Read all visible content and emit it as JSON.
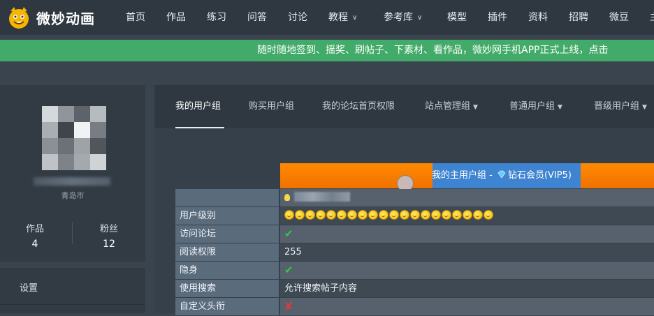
{
  "brand": {
    "name": "微妙动画"
  },
  "nav": {
    "items": [
      {
        "label": "首页"
      },
      {
        "label": "作品"
      },
      {
        "label": "练习"
      },
      {
        "label": "问答"
      },
      {
        "label": "讨论"
      },
      {
        "label": "教程",
        "dropdown": true
      },
      {
        "label": "参考库",
        "dropdown": true
      },
      {
        "label": "模型"
      },
      {
        "label": "插件"
      },
      {
        "label": "资料"
      },
      {
        "label": "招聘"
      },
      {
        "label": "微豆"
      },
      {
        "label": "主"
      }
    ]
  },
  "announcement": {
    "text": "随时随地签到、摇奖、刷帖子、下素材、看作品，微妙网手机APP正式上线，点击"
  },
  "profile": {
    "location": "青岛市",
    "stats": [
      {
        "label": "作品",
        "value": "4"
      },
      {
        "label": "粉丝",
        "value": "12"
      }
    ]
  },
  "side_menu": {
    "settings": "设置"
  },
  "tabs": [
    {
      "label": "我的用户组",
      "active": true
    },
    {
      "label": "购买用户组"
    },
    {
      "label": "我的论坛首页权限"
    },
    {
      "label": "站点管理组",
      "dropdown": true
    },
    {
      "label": "普通用户组",
      "dropdown": true
    },
    {
      "label": "晋级用户组",
      "dropdown": true
    }
  ],
  "group_header": {
    "prefix": "我的主用户组 - ",
    "group": "钻石会员(VIP5)"
  },
  "permissions": [
    {
      "label": "",
      "value_type": "name"
    },
    {
      "label": "用户级别",
      "value_type": "faces",
      "level_faces": 20
    },
    {
      "label": "访问论坛",
      "value_type": "check"
    },
    {
      "label": "阅读权限",
      "value": "255"
    },
    {
      "label": "隐身",
      "value_type": "check"
    },
    {
      "label": "使用搜索",
      "value": "允许搜索帖子内容"
    },
    {
      "label": "自定义头衔",
      "value_type": "cross"
    }
  ],
  "colors": {
    "accent_green": "#43ab6a",
    "header_orange": "#ff8a00",
    "header_blue": "#3e84d0",
    "check_green": "#2ecc40",
    "cross_red": "#e53935"
  }
}
